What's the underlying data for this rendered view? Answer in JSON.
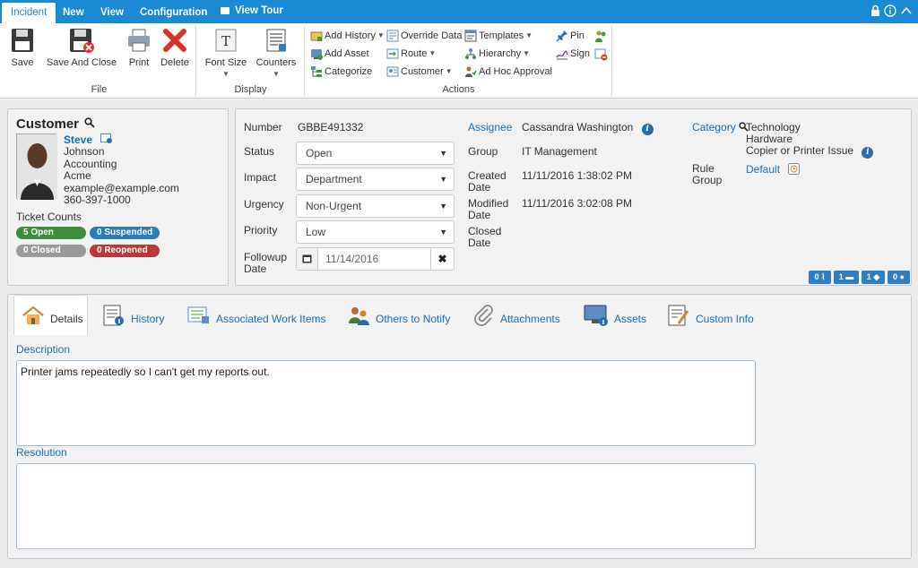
{
  "topbar": {
    "tabs": [
      "Incident",
      "New",
      "View",
      "Configuration"
    ],
    "view_tour": "View Tour"
  },
  "ribbon": {
    "file": {
      "label": "File",
      "save": "Save",
      "save_and_close": "Save And Close",
      "print": "Print",
      "delete": "Delete"
    },
    "display": {
      "label": "Display",
      "font_size": "Font Size",
      "counters": "Counters"
    },
    "actions": {
      "label": "Actions",
      "add_history": "Add History",
      "add_asset": "Add Asset",
      "categorize": "Categorize",
      "override_data": "Override Data",
      "route": "Route",
      "customer": "Customer",
      "templates": "Templates",
      "hierarchy": "Hierarchy",
      "ad_hoc_approval": "Ad Hoc Approval",
      "pin": "Pin",
      "sign": "Sign"
    }
  },
  "customer": {
    "title": "Customer",
    "first_name": "Steve",
    "last_name": "Johnson",
    "department": "Accounting",
    "company": "Acme",
    "email": "example@example.com",
    "phone": "360-397-1000",
    "ticket_counts_label": "Ticket Counts",
    "badges": {
      "open": "5 Open",
      "suspended": "0 Suspended",
      "closed": "0 Closed",
      "reopened": "0 Reopened"
    },
    "colors": {
      "open": "#3c8d3c",
      "suspended": "#2b7db5",
      "closed": "#9a9a9a",
      "reopened": "#b83a3a"
    }
  },
  "ticket": {
    "number_label": "Number",
    "number": "GBBE491332",
    "status_label": "Status",
    "status": "Open",
    "impact_label": "Impact",
    "impact": "Department",
    "urgency_label": "Urgency",
    "urgency": "Non-Urgent",
    "priority_label": "Priority",
    "priority": "Low",
    "followup_label": [
      "Followup",
      "Date"
    ],
    "followup_date": "11/14/2016",
    "assignee_label": "Assignee",
    "assignee": "Cassandra Washington",
    "group_label": "Group",
    "group": "IT Management",
    "created_label": [
      "Created",
      "Date"
    ],
    "created": "11/11/2016 1:38:02 PM",
    "modified_label": [
      "Modified",
      "Date"
    ],
    "modified": "11/11/2016 3:02:08 PM",
    "closed_label": [
      "Closed",
      "Date"
    ],
    "category_label": "Category",
    "category": [
      "Technology",
      "Hardware",
      "Copier or Printer Issue"
    ],
    "rule_group_label": [
      "Rule",
      "Group"
    ],
    "rule_group": "Default",
    "counters": [
      "0",
      "1",
      "1",
      "0"
    ]
  },
  "tabs": {
    "details": "Details",
    "history": "History",
    "associated_work_items": "Associated Work Items",
    "others_to_notify": "Others to Notify",
    "attachments": "Attachments",
    "assets": "Assets",
    "custom_info": "Custom Info"
  },
  "details": {
    "description_label": "Description",
    "description": "Printer jams repeatedly so I can't get my reports out.",
    "resolution_label": "Resolution",
    "resolution": ""
  }
}
